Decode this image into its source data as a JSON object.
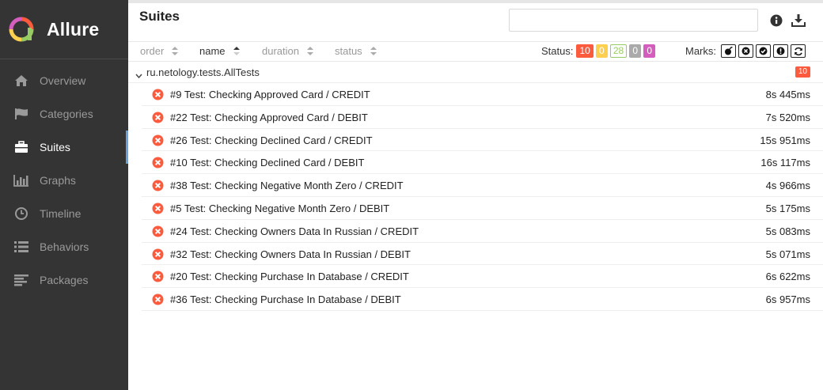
{
  "app": {
    "name": "Allure"
  },
  "sidebar": {
    "items": [
      {
        "label": "Overview",
        "icon": "home-icon"
      },
      {
        "label": "Categories",
        "icon": "flag-icon"
      },
      {
        "label": "Suites",
        "icon": "briefcase-icon",
        "active": true
      },
      {
        "label": "Graphs",
        "icon": "bar-chart-icon"
      },
      {
        "label": "Timeline",
        "icon": "clock-icon"
      },
      {
        "label": "Behaviors",
        "icon": "list-icon"
      },
      {
        "label": "Packages",
        "icon": "align-left-icon"
      }
    ]
  },
  "header": {
    "title": "Suites",
    "search_value": "",
    "search_placeholder": ""
  },
  "toolbar": {
    "sort": [
      {
        "label": "order"
      },
      {
        "label": "name",
        "active": true
      },
      {
        "label": "duration"
      },
      {
        "label": "status"
      }
    ],
    "status_label": "Status:",
    "statuses": [
      {
        "name": "failed",
        "count": "10",
        "bg": "#fd5a3e",
        "fg": "#ffffff",
        "border": "#fd5a3e"
      },
      {
        "name": "broken",
        "count": "0",
        "bg": "#ffd050",
        "fg": "#ffffff",
        "border": "#ffd050"
      },
      {
        "name": "passed",
        "count": "28",
        "bg": "#ffffff",
        "fg": "#97cc64",
        "border": "#97cc64"
      },
      {
        "name": "skipped",
        "count": "0",
        "bg": "#aaaaaa",
        "fg": "#ffffff",
        "border": "#aaaaaa"
      },
      {
        "name": "unknown",
        "count": "0",
        "bg": "#d35ebe",
        "fg": "#ffffff",
        "border": "#d35ebe"
      }
    ],
    "marks_label": "Marks:",
    "marks": [
      "flaky-icon",
      "new-failed-icon",
      "new-passed-icon",
      "new-broken-icon",
      "retries-icon"
    ]
  },
  "suite": {
    "name": "ru.netology.tests.AllTests",
    "count": "10",
    "tests": [
      {
        "name": "#9  Test: Checking Approved Card / CREDIT",
        "duration": "8s 445ms"
      },
      {
        "name": "#22  Test: Checking Approved Card / DEBIT",
        "duration": "7s 520ms"
      },
      {
        "name": "#26  Test: Checking Declined Card / CREDIT",
        "duration": "15s 951ms"
      },
      {
        "name": "#10  Test: Checking Declined Card / DEBIT",
        "duration": "16s 117ms"
      },
      {
        "name": "#38  Test: Checking Negative Month Zero / CREDIT",
        "duration": "4s 966ms"
      },
      {
        "name": "#5  Test: Checking Negative Month Zero / DEBIT",
        "duration": "5s 175ms"
      },
      {
        "name": "#24  Test: Checking Owners Data In Russian / CREDIT",
        "duration": "5s 083ms"
      },
      {
        "name": "#32  Test: Checking Owners Data In Russian / DEBIT",
        "duration": "5s 071ms"
      },
      {
        "name": "#20  Test: Checking Purchase In Database / CREDIT",
        "duration": "6s 622ms"
      },
      {
        "name": "#36  Test: Checking Purchase In Database / DEBIT",
        "duration": "6s 957ms"
      }
    ]
  },
  "colors": {
    "sidebar_bg": "#343434",
    "accent": "#6ba2d8",
    "failed": "#fd5a3e"
  }
}
